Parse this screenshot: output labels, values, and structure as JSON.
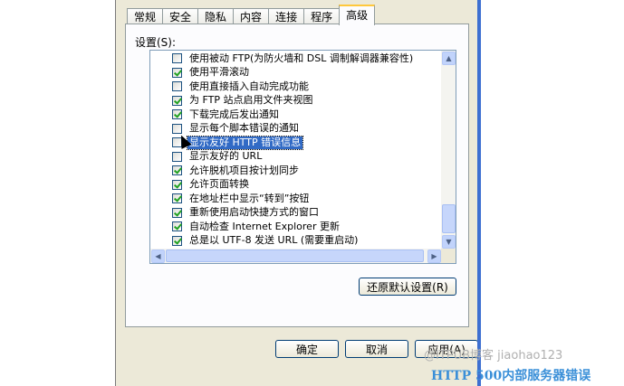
{
  "tabs": [
    "常规",
    "安全",
    "隐私",
    "内容",
    "连接",
    "程序",
    "高级"
  ],
  "active_tab": "高级",
  "settings_label": "设置(S):",
  "settings_items": [
    {
      "label": "使用被动 FTP(为防火墙和 DSL 调制解调器兼容性)",
      "checked": false
    },
    {
      "label": "使用平滑滚动",
      "checked": true
    },
    {
      "label": "使用直接插入自动完成功能",
      "checked": false
    },
    {
      "label": "为 FTP 站点启用文件夹视图",
      "checked": true
    },
    {
      "label": "下载完成后发出通知",
      "checked": true
    },
    {
      "label": "显示每个脚本错误的通知",
      "checked": false
    },
    {
      "label": "显示友好 HTTP 错误信息",
      "checked": false,
      "selected": true
    },
    {
      "label": "显示友好的 URL",
      "checked": false
    },
    {
      "label": "允许脱机项目按计划同步",
      "checked": true
    },
    {
      "label": "允许页面转换",
      "checked": true
    },
    {
      "label": "在地址栏中显示“转到”按钮",
      "checked": true
    },
    {
      "label": "重新使用启动快捷方式的窗口",
      "checked": true
    },
    {
      "label": "自动检查 Internet Explorer 更新",
      "checked": true
    },
    {
      "label": "总是以 UTF-8 发送 URL (需要重启动)",
      "checked": true
    }
  ],
  "buttons": {
    "restore": "还原默认设置(R)",
    "ok": "确定",
    "cancel": "取消",
    "apply": "应用(A)"
  },
  "watermark": "@ITPUB博客 jiaohao123",
  "caption": "HTTP 500内部服务器错误"
}
